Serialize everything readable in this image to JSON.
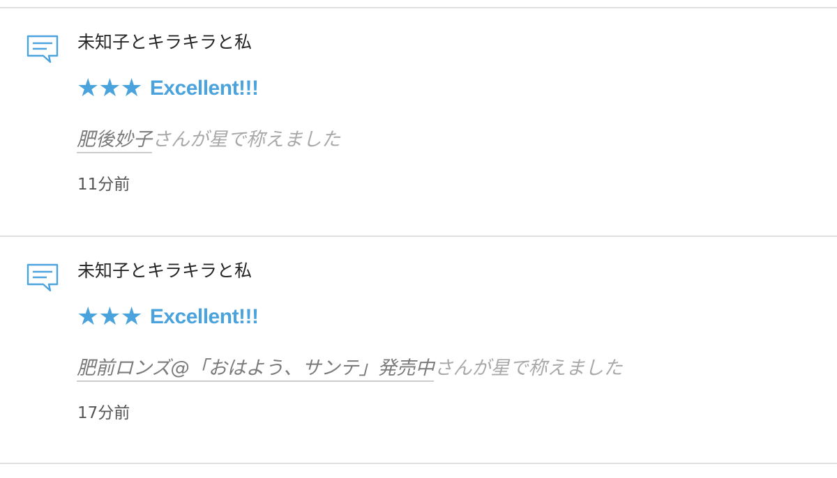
{
  "notifications": [
    {
      "icon": "comment-icon",
      "title": "未知子とキラキラと私",
      "stars": "★★★",
      "rating_label": "Excellent!!!",
      "user": "肥後妙子",
      "message_suffix": "さんが星で称えました",
      "time": "11分前"
    },
    {
      "icon": "comment-icon",
      "title": "未知子とキラキラと私",
      "stars": "★★★",
      "rating_label": "Excellent!!!",
      "user": "肥前ロンズ@「おはよう、サンテ」発売中",
      "message_suffix": "さんが星で称えました",
      "time": "17分前"
    }
  ],
  "colors": {
    "accent": "#4aa3dd",
    "divider": "#e0e0e0",
    "title": "#262626",
    "muted": "#a9a9a9"
  }
}
